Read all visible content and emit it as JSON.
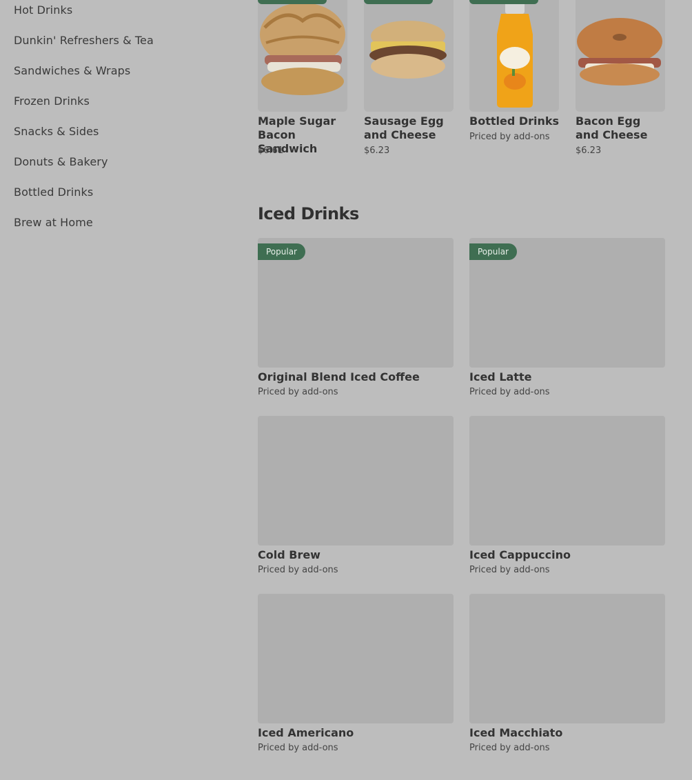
{
  "sidebar": {
    "items": [
      {
        "label": "Hot Drinks"
      },
      {
        "label": "Dunkin' Refreshers & Tea"
      },
      {
        "label": "Sandwiches & Wraps"
      },
      {
        "label": "Frozen Drinks"
      },
      {
        "label": "Snacks & Sides"
      },
      {
        "label": "Donuts & Bakery"
      },
      {
        "label": "Bottled Drinks"
      },
      {
        "label": "Brew at Home"
      }
    ]
  },
  "top_row": {
    "items": [
      {
        "name": "Maple Sugar Bacon Sandwich",
        "price": "$6.61",
        "image": "croissant-sandwich"
      },
      {
        "name": "Sausage Egg and Cheese",
        "price": "$6.23",
        "image": "english-muffin-sandwich"
      },
      {
        "name": "Bottled Drinks",
        "price": "Priced by add-ons",
        "image": "orange-juice-bottle"
      },
      {
        "name": "Bacon Egg and Cheese",
        "price": "$6.23",
        "image": "bagel-sandwich"
      }
    ]
  },
  "iced_drinks": {
    "title": "Iced Drinks",
    "items": [
      {
        "name": "Original Blend Iced Coffee",
        "price": "Priced by add-ons",
        "badge": "Popular"
      },
      {
        "name": "Iced Latte",
        "price": "Priced by add-ons",
        "badge": "Popular"
      },
      {
        "name": "Cold Brew",
        "price": "Priced by add-ons",
        "badge": ""
      },
      {
        "name": "Iced Cappuccino",
        "price": "Priced by add-ons",
        "badge": ""
      },
      {
        "name": "Iced Americano",
        "price": "Priced by add-ons",
        "badge": ""
      },
      {
        "name": "Iced Macchiato",
        "price": "Priced by add-ons",
        "badge": ""
      }
    ]
  },
  "colors": {
    "overlay_bg": "#bdbdbd",
    "badge_bg": "#3f6e52",
    "placeholder": "#afafaf"
  }
}
